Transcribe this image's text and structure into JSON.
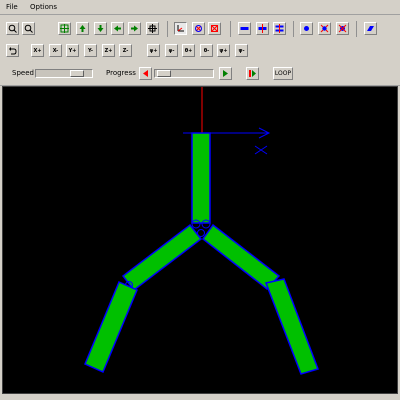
{
  "menu": {
    "file": "File",
    "options": "Options"
  },
  "playback": {
    "speed_label": "Speed",
    "progress_label": "Progress",
    "loop_label": "LOOP",
    "speed_value": 0.8,
    "progress_value": 0.05
  },
  "axis_buttons": [
    "X+",
    "X-",
    "Y+",
    "Y-",
    "Z+",
    "Z-"
  ],
  "joint_buttons": [
    "φ+",
    "φ-",
    "θ+",
    "θ-",
    "ψ+",
    "ψ-"
  ],
  "colors": {
    "canvas_bg": "#000000",
    "limb_fill": "#00c000",
    "limb_outline": "#0000ff",
    "axis_red": "#ff0000",
    "axis_blue": "#0000ff"
  }
}
